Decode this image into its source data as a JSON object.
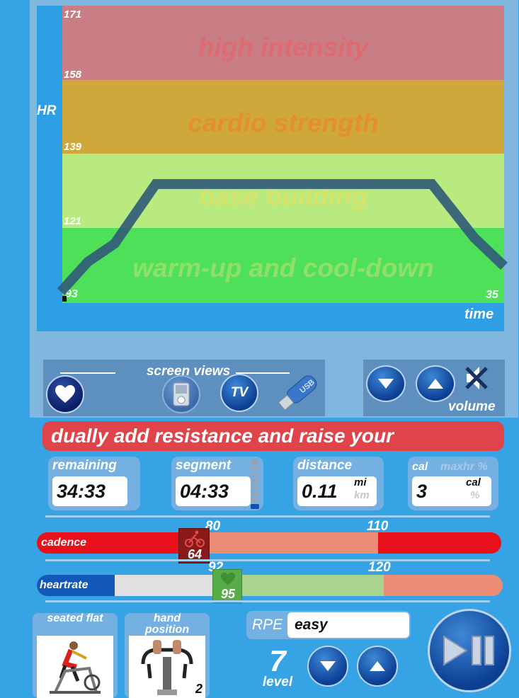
{
  "chart": {
    "y_axis_label": "HR",
    "x_axis_label": "time",
    "hr_ticks": [
      "171",
      "158",
      "139",
      "121"
    ],
    "hr_start": "93",
    "time_end": "35",
    "zones": [
      {
        "label": "high intensity",
        "color": "#c97e86",
        "text_color": "#de6a72"
      },
      {
        "label": "cardio strength",
        "color": "#cfa83c",
        "text_color": "#e3902a"
      },
      {
        "label": "base building",
        "color": "#b8ea80",
        "text_color": "#d6e36a"
      },
      {
        "label": "warm-up and cool-down",
        "color": "#4fe05a",
        "text_color": "#8fe06a"
      }
    ]
  },
  "screen_views": {
    "title": "screen views",
    "heart_icon": "heart-icon",
    "ipod_icon": "music-player-icon",
    "tv_label": "TV",
    "usb_label": "USB"
  },
  "volume": {
    "label": "volume",
    "down_icon": "chevron-down-icon",
    "up_icon": "chevron-up-icon",
    "mute_icon": "mute-icon"
  },
  "message": "dually add resistance and raise your",
  "stats": {
    "remaining": {
      "label": "remaining",
      "value": "34:33"
    },
    "segment": {
      "label": "segment",
      "value": "04:33"
    },
    "distance": {
      "label": "distance",
      "value": "0.11",
      "unit_active": "mi",
      "unit_inactive": "km"
    },
    "cal": {
      "label": "cal",
      "label_alt": "maxhr %",
      "value": "3",
      "unit_active": "cal",
      "unit_inactive": "%"
    }
  },
  "cadence": {
    "label": "cadence",
    "low": "80",
    "high": "110",
    "value": "64",
    "icon": "cyclist-icon"
  },
  "heartrate": {
    "label": "heartrate",
    "low": "92",
    "high": "120",
    "value": "95",
    "icon": "heart-icon"
  },
  "tiles": {
    "seated": {
      "label": "seated flat"
    },
    "hand": {
      "label": "hand position",
      "number": "2"
    }
  },
  "rpe": {
    "label": "RPE",
    "value": "easy"
  },
  "level": {
    "value": "7",
    "label": "level"
  },
  "colors": {
    "background": "#36a3e4",
    "message": "#e0444a",
    "cadence_red": "#e8101a",
    "zone_salmon": "#ec8d78",
    "hr_green": "#a8d48e",
    "button_blue": "#0b3f94"
  }
}
